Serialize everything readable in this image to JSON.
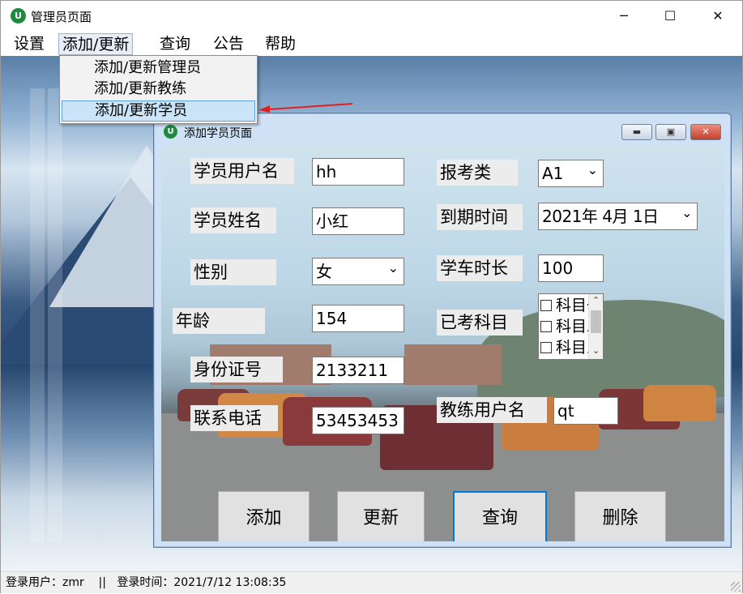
{
  "window": {
    "title": "管理员页面",
    "icon": "app-logo-icon",
    "controls": {
      "minimize": "─",
      "maximize": "☐",
      "close": "✕"
    }
  },
  "menubar": {
    "items": [
      "设置",
      "添加/更新",
      "查询",
      "公告",
      "帮助"
    ],
    "active_index": 1
  },
  "dropdown": {
    "items": [
      "添加/更新管理员",
      "添加/更新教练",
      "添加/更新学员"
    ],
    "highlighted_index": 2
  },
  "child_window": {
    "title": "添加学员页面",
    "controls": {
      "minimize": "▬",
      "restore": "▣",
      "close": "✕"
    },
    "fields": {
      "username": {
        "label": "学员用户名",
        "value": "hh"
      },
      "name": {
        "label": "学员姓名",
        "value": "小红"
      },
      "gender": {
        "label": "性别",
        "value": "女"
      },
      "age": {
        "label": "年龄",
        "value": "154"
      },
      "id_number": {
        "label": "身份证号",
        "value": "2133211"
      },
      "phone": {
        "label": "联系电话",
        "value": "53453453"
      },
      "license_class": {
        "label": "报考类",
        "value": "A1"
      },
      "expiry_date": {
        "label": "到期时间",
        "value": "2021年  4月  1日"
      },
      "study_hours": {
        "label": "学车时长",
        "value": "100"
      },
      "passed_subjects": {
        "label": "已考科目",
        "items": [
          "科目一",
          "科目二",
          "科目三"
        ]
      },
      "coach_username": {
        "label": "教练用户名",
        "value": "qt"
      }
    },
    "buttons": {
      "add": "添加",
      "update": "更新",
      "query": "查询",
      "delete": "删除"
    },
    "focused_button": "query"
  },
  "statusbar": {
    "text": "登录用户：zmr    ||   登录时间：2021/7/12 13:08:35"
  },
  "colors": {
    "menu_highlight": "#cce4f7",
    "arrow": "#e02020",
    "focus_border": "#0078d7"
  }
}
